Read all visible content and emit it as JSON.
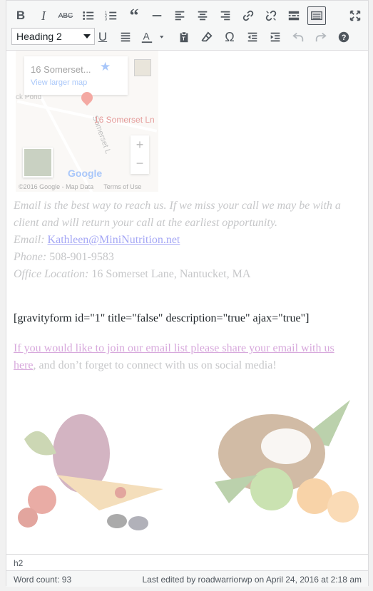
{
  "toolbar": {
    "format_value": "Heading 2",
    "row1": [
      "bold-icon",
      "italic-icon",
      "strikethrough-icon",
      "bullet-list-icon",
      "numbered-list-icon",
      "blockquote-icon",
      "horizontal-line-icon",
      "align-left-icon",
      "align-center-icon",
      "align-right-icon",
      "link-icon",
      "unlink-icon",
      "read-more-icon",
      "toolbar-toggle-icon",
      "fullscreen-icon"
    ],
    "row2": [
      "underline-icon",
      "justify-icon",
      "text-color-icon",
      "paste-text-icon",
      "clear-formatting-icon",
      "special-character-icon",
      "outdent-icon",
      "indent-icon",
      "undo-icon",
      "redo-icon",
      "help-icon"
    ]
  },
  "map": {
    "place_title": "16 Somerset...",
    "larger_map_link": "View larger map",
    "pin_label": "16 Somerset Ln",
    "street_label": "Somerset L",
    "pond_label": "ck Pond",
    "zoom_in": "+",
    "zoom_out": "−",
    "logo": "Google",
    "attribution": "©2016 Google - Map Data",
    "terms": "Terms of Use"
  },
  "content": {
    "intro": " Email is the best way to reach us. If we miss your call we may be with a client and will return your call at the earliest opportunity.",
    "email_label": "Email: ",
    "email_value": "Kathleen@MiniNutrition.net",
    "phone_label": "Phone: ",
    "phone_value": "508-901-9583",
    "office_label": "Office Location: ",
    "office_value": "16 Somerset Lane, Nantucket, MA",
    "shortcode": "[gravityform id=\"1\" title=\"false\" description=\"true\" ajax=\"true\"]",
    "email_list_link": "If you would like to join our email list please share your email with us here",
    "email_list_rest": ", and don’t forget to connect with us on social  media!"
  },
  "status": {
    "path": "h2",
    "word_count": "Word count: 93",
    "last_edited": "Last edited by roadwarriorwp on April 24, 2016 at 2:18 am"
  },
  "colors": {
    "link": "#a5a7f5",
    "visited_link": "#d7a8dc",
    "faded_text": "#c6c7c9"
  }
}
